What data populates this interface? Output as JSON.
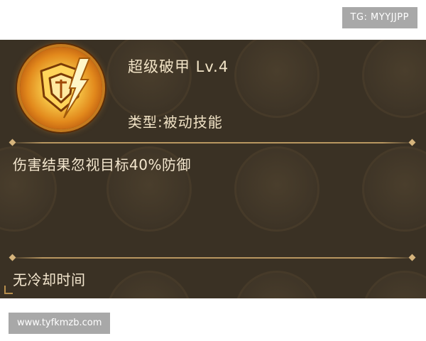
{
  "watermark_top": "TG: MYYJJPP",
  "watermark_bottom": "www.tyfkmzb.com",
  "skill": {
    "name": "超级破甲 Lv.4",
    "type": "类型:被动技能",
    "effect": "伤害结果忽视目标40%防御",
    "cooldown": "无冷却时间",
    "icon": "armor-break-icon"
  },
  "colors": {
    "panel_bg": "#3a3124",
    "text": "#f1e3c6",
    "divider": "#b89660",
    "icon_glow": "#f6c546"
  }
}
